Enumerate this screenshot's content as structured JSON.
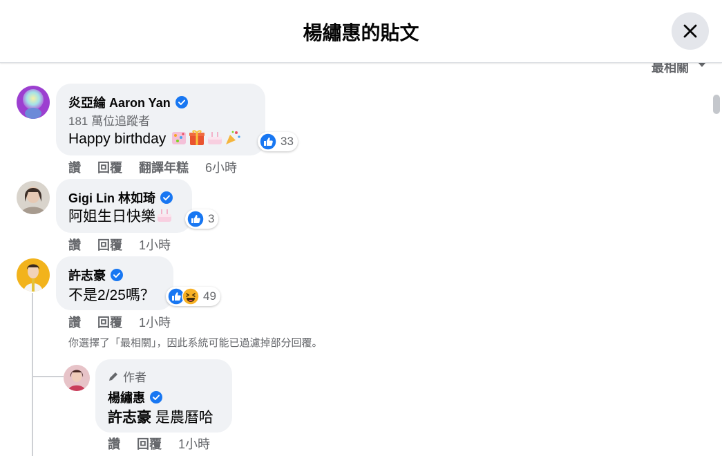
{
  "header": {
    "title": "楊繡惠的貼文"
  },
  "sort": {
    "label": "最相關"
  },
  "comments": [
    {
      "name": "炎亞綸 Aaron Yan",
      "subtitle": "181 萬位追蹤者",
      "text": "Happy birthday",
      "reaction_count": "33",
      "actions": [
        "讚",
        "回覆",
        "翻譯年糕"
      ],
      "time": "6小時"
    },
    {
      "name": "Gigi Lin 林如琦",
      "text": "阿姐生日快樂",
      "reaction_count": "3",
      "actions": [
        "讚",
        "回覆"
      ],
      "time": "1小時"
    },
    {
      "name": "許志豪",
      "text": "不是2/25嗎？",
      "reaction_count": "49",
      "actions": [
        "讚",
        "回覆"
      ],
      "time": "1小時"
    }
  ],
  "filter_note": "你選擇了「最相關」，因此系統可能已過濾掉部分回覆。",
  "reply": {
    "author_badge": "作者",
    "name": "楊繡惠",
    "mention": "許志豪",
    "text": "是農曆哈",
    "actions": [
      "讚",
      "回覆"
    ],
    "time": "1小時"
  },
  "colors": {
    "verified": "#1877f2",
    "like": "#1877f2",
    "bubble": "#f0f2f5",
    "secondary_text": "#65676b"
  },
  "icons": [
    "close-icon",
    "sort-caret-icon",
    "verified-badge-icon",
    "like-reaction-icon",
    "haha-reaction-icon",
    "pencil-icon"
  ]
}
